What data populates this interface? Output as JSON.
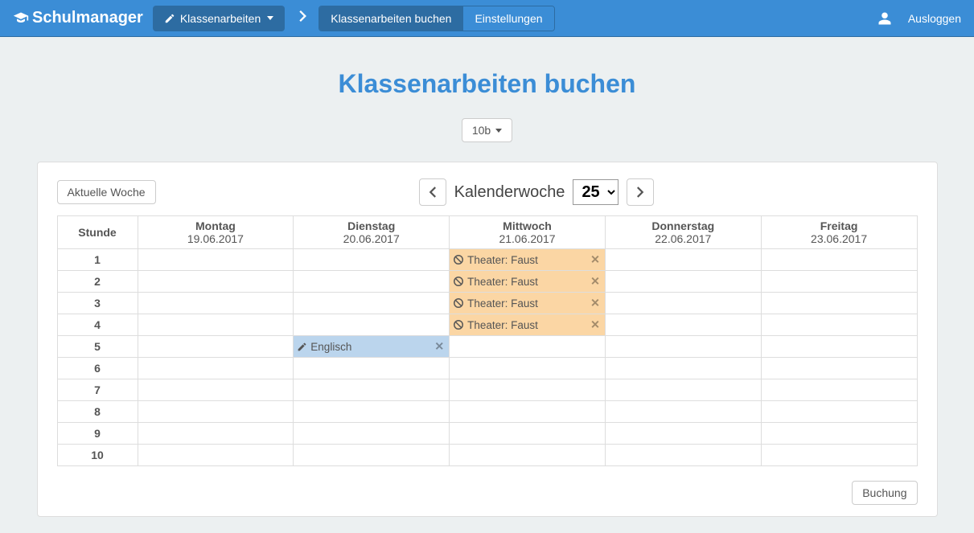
{
  "nav": {
    "brand": "Schulmanager",
    "dropdown": "Klassenarbeiten",
    "tabs": {
      "book": "Klassenarbeiten buchen",
      "settings": "Einstellungen"
    },
    "logout": "Ausloggen"
  },
  "page": {
    "title": "Klassenarbeiten buchen",
    "class_selector": "10b",
    "current_week_btn": "Aktuelle Woche",
    "kw_label": "Kalenderwoche",
    "kw_value": "25",
    "booking_btn": "Buchung"
  },
  "table": {
    "hour_header": "Stunde",
    "days": [
      {
        "name": "Montag",
        "date": "19.06.2017"
      },
      {
        "name": "Dienstag",
        "date": "20.06.2017"
      },
      {
        "name": "Mittwoch",
        "date": "21.06.2017"
      },
      {
        "name": "Donnerstag",
        "date": "22.06.2017"
      },
      {
        "name": "Freitag",
        "date": "23.06.2017"
      }
    ],
    "hours": [
      "1",
      "2",
      "3",
      "4",
      "5",
      "6",
      "7",
      "8",
      "9",
      "10"
    ],
    "events": [
      {
        "day": 2,
        "hour": 0,
        "text": "Theater: Faust",
        "variant": "orange",
        "icon": "ban"
      },
      {
        "day": 2,
        "hour": 1,
        "text": "Theater: Faust",
        "variant": "orange",
        "icon": "ban"
      },
      {
        "day": 2,
        "hour": 2,
        "text": "Theater: Faust",
        "variant": "orange",
        "icon": "ban"
      },
      {
        "day": 2,
        "hour": 3,
        "text": "Theater: Faust",
        "variant": "orange",
        "icon": "ban"
      },
      {
        "day": 1,
        "hour": 4,
        "text": "Englisch",
        "variant": "blue",
        "icon": "edit"
      }
    ]
  }
}
